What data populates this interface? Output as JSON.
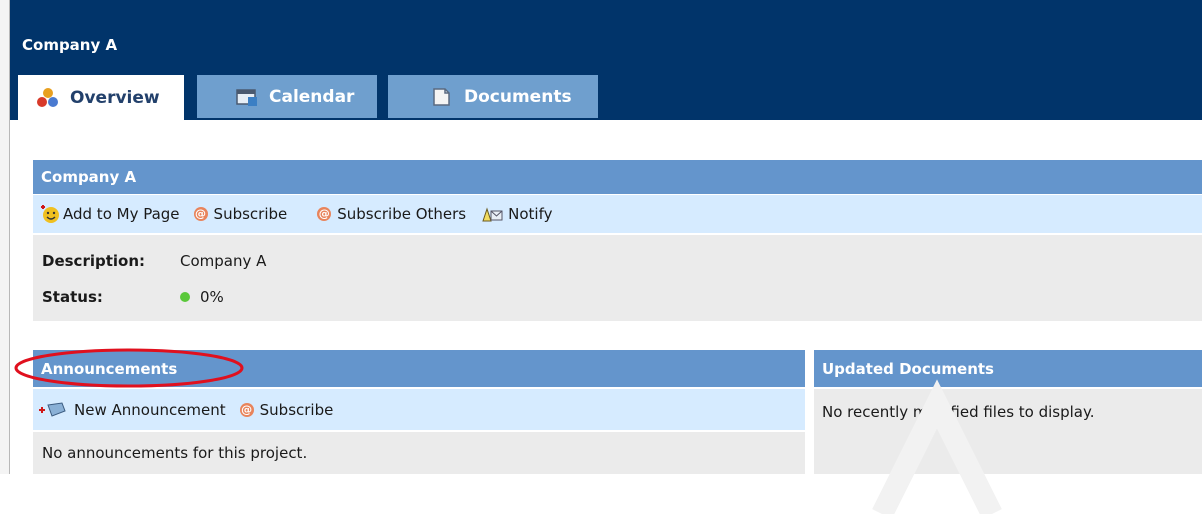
{
  "header": {
    "title": "Company A"
  },
  "tabs": [
    {
      "label": "Overview",
      "icon": "overview-icon",
      "active": true
    },
    {
      "label": "Calendar",
      "icon": "calendar-icon",
      "active": false
    },
    {
      "label": "Documents",
      "icon": "documents-icon",
      "active": false
    }
  ],
  "project": {
    "title": "Company A",
    "actions": {
      "add_to_my_page": "Add to My Page",
      "subscribe": "Subscribe",
      "subscribe_others": "Subscribe Others",
      "notify": "Notify"
    },
    "description_label": "Description:",
    "description_value": "Company A",
    "status_label": "Status:",
    "status_value": "0%"
  },
  "announcements": {
    "title": "Announcements",
    "new_label": "New Announcement",
    "subscribe_label": "Subscribe",
    "empty_text": "No announcements for this project."
  },
  "updated_documents": {
    "title": "Updated Documents",
    "empty_text": "No recently modified files to display."
  },
  "colors": {
    "header_bg": "#01346a",
    "tab_inactive": "#6f9fce",
    "panel_head": "#6495cc",
    "light_bar": "#d6ebff",
    "grey_bar": "#ebebeb",
    "highlight_ellipse": "#e0101e",
    "status_dot": "#5ac83a"
  }
}
